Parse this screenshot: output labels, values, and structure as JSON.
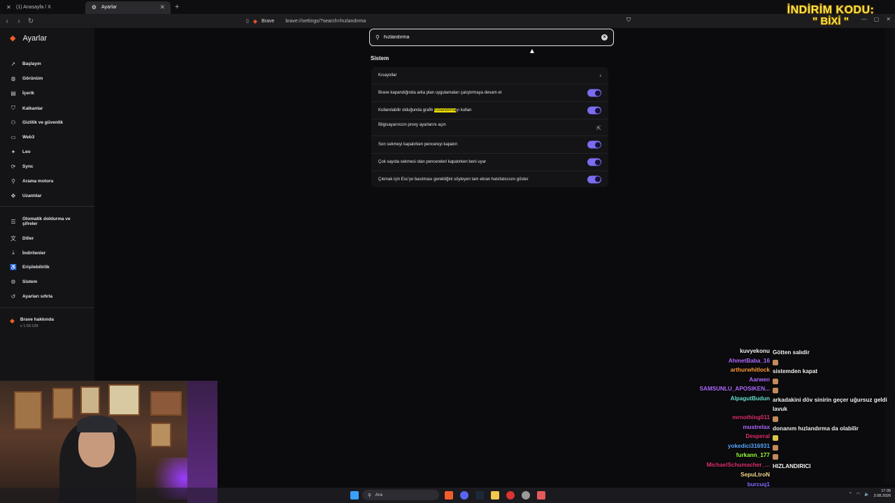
{
  "tabs": [
    {
      "label": "(1) Anasayfa / X",
      "icon": "x-icon"
    },
    {
      "label": "Ayarlar",
      "icon": "gear-icon",
      "active": true
    }
  ],
  "address": {
    "brand": "Brave",
    "url": "brave://settings/?search=hızlandırma"
  },
  "sidebar": {
    "title": "Ayarlar",
    "items": [
      {
        "label": "Başlayın",
        "icon": "rocket-icon"
      },
      {
        "label": "Görünüm",
        "icon": "palette-icon"
      },
      {
        "label": "İçerik",
        "icon": "content-icon"
      },
      {
        "label": "Kalkanlar",
        "icon": "shield-icon"
      },
      {
        "label": "Gizlilik ve güvenlik",
        "icon": "privacy-icon"
      },
      {
        "label": "Web3",
        "icon": "wallet-icon"
      },
      {
        "label": "Leo",
        "icon": "leo-icon"
      },
      {
        "label": "Sync",
        "icon": "sync-icon"
      },
      {
        "label": "Arama motoru",
        "icon": "search-icon"
      },
      {
        "label": "Uzantılar",
        "icon": "puzzle-icon"
      },
      {
        "label": "Otomatik doldurma ve şifreler",
        "icon": "list-icon"
      },
      {
        "label": "Diller",
        "icon": "translate-icon"
      },
      {
        "label": "İndirilenler",
        "icon": "download-icon"
      },
      {
        "label": "Erişilebilirlik",
        "icon": "accessibility-icon"
      },
      {
        "label": "Sistem",
        "icon": "system-icon"
      },
      {
        "label": "Ayarları sıfırla",
        "icon": "reset-icon"
      }
    ],
    "about": {
      "label": "Brave hakkında",
      "version": "v 1.93.129"
    }
  },
  "search": {
    "value": "hızlandırma"
  },
  "section": {
    "title": "Sistem"
  },
  "rows": [
    {
      "text": "Kısayollar",
      "trail": "chevron"
    },
    {
      "text": "Brave kapandığında arka plan uygulamaları çalıştırmaya devam et",
      "trail": "toggle"
    },
    {
      "pre": "Kullanılabilir olduğunda grafik ",
      "hl": "hızlandırma",
      "post": "yı kullan",
      "trail": "toggle"
    },
    {
      "text": "Bilgisayarınızın proxy ayarlarını açın",
      "trail": "external"
    },
    {
      "text": "Son sekmeyi kapatırken pencereyi kapatın",
      "trail": "toggle"
    },
    {
      "text": "Çok sayıda sekmesi olan pencereleri kapatırken beni uyar",
      "trail": "toggle"
    },
    {
      "text": "Çıkmak için Esc'ye basılması gerektiğini söyleyen tam ekran hatırlatıcısını göster",
      "trail": "toggle"
    }
  ],
  "overlay": {
    "line1": "İNDİRİM KODU:",
    "line2": "\" BİXİ \""
  },
  "chat": [
    {
      "nick": "kuvyekonu",
      "text": "Götten salıdir",
      "color": "#f2f2f2"
    },
    {
      "nick": "AhmetBaba_16",
      "text": "",
      "color": "#b06bff",
      "emote": true
    },
    {
      "nick": "arthurwhitlock",
      "text": "sistemden kapat",
      "color": "#ff9c3a"
    },
    {
      "nick": "Aarwen",
      "text": "",
      "color": "#b06bff",
      "emote": true
    },
    {
      "nick": "SAMSUNLU_APOSIKEN...",
      "text": "",
      "color": "#b06bff",
      "emote": true
    },
    {
      "nick": "AlpagutBudun",
      "text": "arkadakini döv sinirin geçer uğursuz geldi lavuk",
      "color": "#6ce0d0"
    },
    {
      "nick": "mrnothing011",
      "text": "",
      "color": "#e0306a",
      "emote": true
    },
    {
      "nick": "mustrelax",
      "text": "donanım hızlandırma da olabilir",
      "color": "#b06bff"
    },
    {
      "nick": "Desperal",
      "text": "",
      "color": "#e0306a",
      "emote": true
    },
    {
      "nick": "yokedici316931",
      "text": "",
      "color": "#5aa8ff",
      "emote": true
    },
    {
      "nick": "furkann_177",
      "text": "",
      "color": "#9cff3a",
      "emote": true
    },
    {
      "nick": "MichaelSchumacher_...",
      "text": "HIZLANDIRICI",
      "color": "#e0306a"
    },
    {
      "nick": "SepuLtroN",
      "text": "",
      "color": "#f5d88a"
    },
    {
      "nick": "burcuq1",
      "text": "",
      "color": "#8a6bff"
    }
  ],
  "taskbar": {
    "search_label": "Ara",
    "time": "17:35",
    "date": "3.08.2026"
  },
  "colors": {
    "accent": "#7b6cf0",
    "brave_orange": "#f25d2b",
    "highlight": "#f2e300"
  }
}
